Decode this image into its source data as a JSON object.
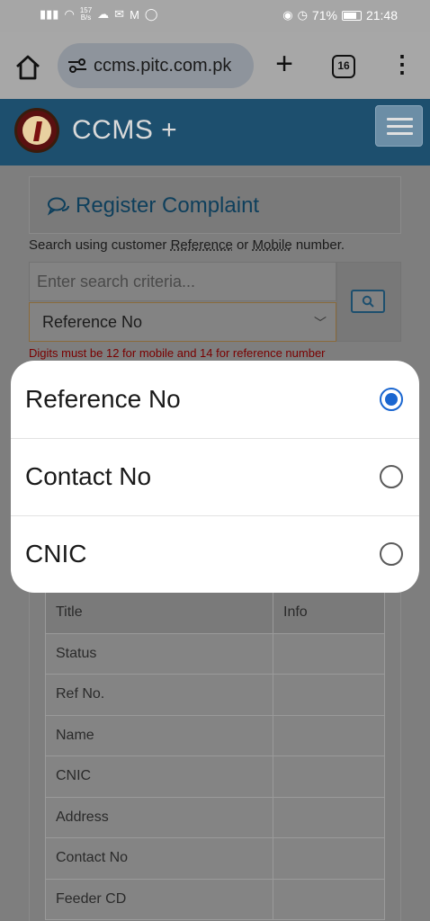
{
  "status_bar": {
    "net_speed_value": "157",
    "net_speed_unit": "B/s",
    "battery": "71%",
    "time": "21:48"
  },
  "browser": {
    "url": "ccms.pitc.com.pk",
    "tab_count": "16"
  },
  "site": {
    "brand": "CCMS +"
  },
  "page": {
    "title": "Register Complaint",
    "help_prefix": "Search using customer ",
    "help_ref": "Reference",
    "help_or": " or ",
    "help_mobile": "Mobile",
    "help_suffix": " number.",
    "search_placeholder": "Enter search criteria...",
    "selected_option": "Reference No",
    "error": "Digits must be 12 for mobile and 14 for reference number"
  },
  "table": {
    "headers": [
      "Title",
      "Info"
    ],
    "rows": [
      "Status",
      "Ref No.",
      "Name",
      "CNIC",
      "Address",
      "Contact No",
      "Feeder CD"
    ]
  },
  "popup": {
    "options": [
      {
        "label": "Reference No",
        "selected": true
      },
      {
        "label": "Contact No",
        "selected": false
      },
      {
        "label": "CNIC",
        "selected": false
      }
    ]
  },
  "colors": {
    "header": "#1d4f6e",
    "title": "#0e3f5c",
    "radio_selected": "#1a66d0",
    "error": "#7a0000"
  }
}
